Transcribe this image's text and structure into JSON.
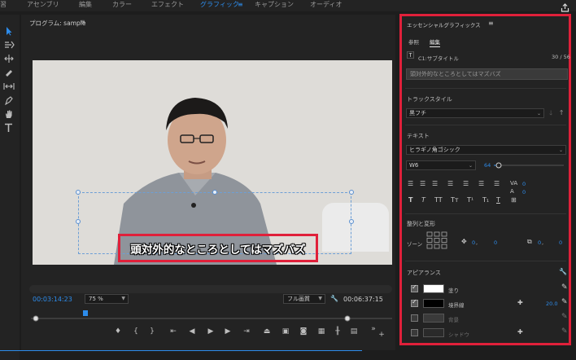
{
  "workspace": {
    "tabs": [
      {
        "label": "習",
        "active": false
      },
      {
        "label": "アセンブリ",
        "active": false
      },
      {
        "label": "編集",
        "active": false
      },
      {
        "label": "カラー",
        "active": false
      },
      {
        "label": "エフェクト",
        "active": false
      },
      {
        "label": "グラフィック",
        "active": true
      },
      {
        "label": "キャプション",
        "active": false
      },
      {
        "label": "オーディオ",
        "active": false
      }
    ],
    "menu_glyph": "≡"
  },
  "program": {
    "title": "プログラム: sample",
    "menu_glyph": "≡",
    "subtitle_text": "頭対外的なところとしてはマズバズ",
    "timecode_current": "00:03:14:23",
    "zoom": "75 %",
    "quality": "フル画質",
    "timecode_duration": "00:06:37:15"
  },
  "essential_graphics": {
    "title": "エッセンシャルグラフィックス",
    "menu_glyph": "≡",
    "tabs": [
      {
        "label": "参照",
        "active": false
      },
      {
        "label": "編集",
        "active": true
      }
    ],
    "layer_name": "C1:サブタイトル",
    "char_count": "30 / 56",
    "text_value": "頭対外的なところとしてはマズバズ",
    "track_style": {
      "heading": "トラックスタイル",
      "value": "黒フチ"
    },
    "text_section": {
      "heading": "テキスト",
      "font": "ヒラギノ角ゴシック",
      "weight": "W6",
      "size": "64",
      "tracking": "0",
      "kerning": "0"
    },
    "align_section": {
      "heading": "整列と変形",
      "zone_label": "ゾーン",
      "pos_x": "0",
      "pos_y": "0",
      "rot_x": "0",
      "rot_y": "0"
    },
    "appearance": {
      "heading": "アピアランス",
      "rows": [
        {
          "label": "塗り",
          "checked": true,
          "color": "#ffffff",
          "value": ""
        },
        {
          "label": "境界線",
          "checked": true,
          "color": "#000000",
          "value": "20.0"
        },
        {
          "label": "背景",
          "checked": false,
          "color": "#3a3a3a",
          "value": ""
        },
        {
          "label": "シャドウ",
          "checked": false,
          "color": "#2a2a2a",
          "value": ""
        }
      ]
    }
  },
  "colors": {
    "accent": "#2d8ceb",
    "highlight": "#e0203a"
  }
}
